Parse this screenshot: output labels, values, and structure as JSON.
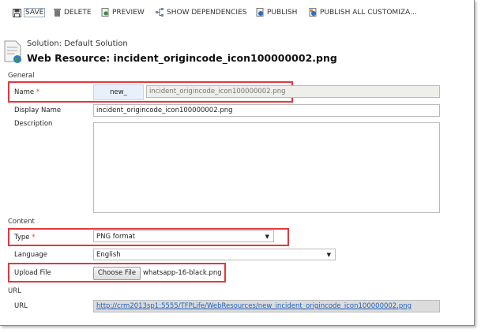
{
  "toolbar": {
    "save": "SAVE",
    "delete": "DELETE",
    "preview": "PREVIEW",
    "show_dependencies": "SHOW DEPENDENCIES",
    "publish": "PUBLISH",
    "publish_all": "PUBLISH ALL CUSTOMIZA..."
  },
  "header": {
    "solution": "Solution: Default Solution",
    "title": "Web Resource: incident_origincode_icon100000002.png"
  },
  "general": {
    "section": "General",
    "name_label": "Name",
    "required": "*",
    "prefix": "new_",
    "name_value": "incident_origincode_icon100000002.png",
    "display_name_label": "Display Name",
    "display_name_value": "incident_origincode_icon100000002.png",
    "description_label": "Description",
    "description_value": ""
  },
  "content": {
    "section": "Content",
    "type_label": "Type",
    "type_value": "PNG format",
    "language_label": "Language",
    "language_value": "English",
    "upload_label": "Upload File",
    "choose_file": "Choose File",
    "file_name": "whatsapp-16-black.png"
  },
  "url": {
    "section": "URL",
    "label": "URL",
    "value": "http://crm2013sp1:5555/TFPLife/WebResources/new_incident_origincode_icon100000002.png"
  }
}
